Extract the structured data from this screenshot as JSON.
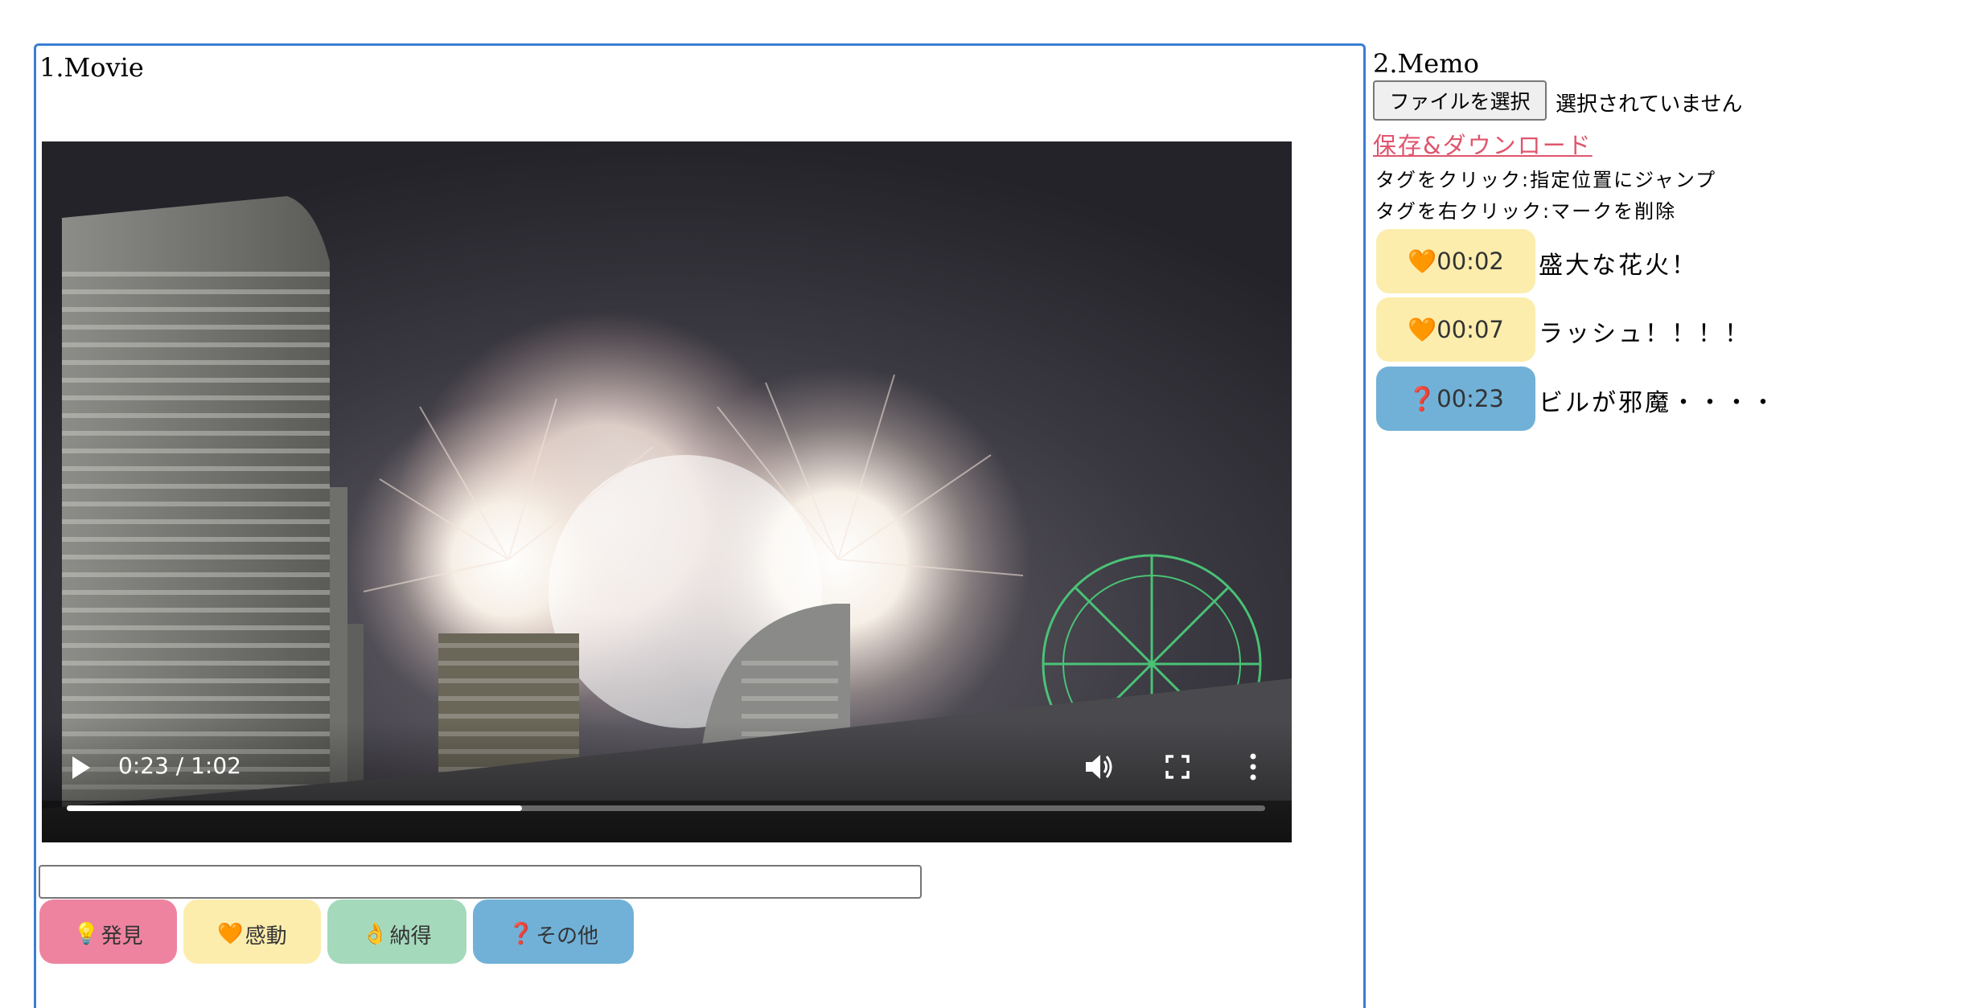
{
  "movie": {
    "title": "1.Movie",
    "time_display": "0:23 / 1:02",
    "progress_fraction": 0.38
  },
  "input": {
    "value": "",
    "placeholder": ""
  },
  "tag_buttons": [
    {
      "icon": "💡",
      "icon_name": "lightbulb-icon",
      "label": "発見",
      "color": "#ee83a0"
    },
    {
      "icon": "🧡",
      "icon_name": "orange-heart-icon",
      "label": "感動",
      "color": "#fcedad"
    },
    {
      "icon": "👌",
      "icon_name": "ok-hand-icon",
      "label": "納得",
      "color": "#a5d9bc"
    },
    {
      "icon": "❓",
      "icon_name": "question-mark-icon",
      "label": "その他",
      "color": "#71b1d7"
    }
  ],
  "memo": {
    "title": "2.Memo",
    "file_button_label": "ファイルを選択",
    "file_status": "選択されていません",
    "save_link": "保存&ダウンロード",
    "hints": [
      "タグをクリック:指定位置にジャンプ",
      "タグを右クリック:マークを削除"
    ],
    "marks": [
      {
        "icon": "🧡",
        "icon_name": "orange-heart-icon",
        "time": "00:02",
        "text": "盛大な花火！",
        "color": "#fcedad"
      },
      {
        "icon": "🧡",
        "icon_name": "orange-heart-icon",
        "time": "00:07",
        "text": "ラッシュ！！！！",
        "color": "#fcedad"
      },
      {
        "icon": "❓",
        "icon_name": "question-mark-icon",
        "time": "00:23",
        "text": "ビルが邪魔・・・・",
        "color": "#71b1d7"
      }
    ]
  }
}
